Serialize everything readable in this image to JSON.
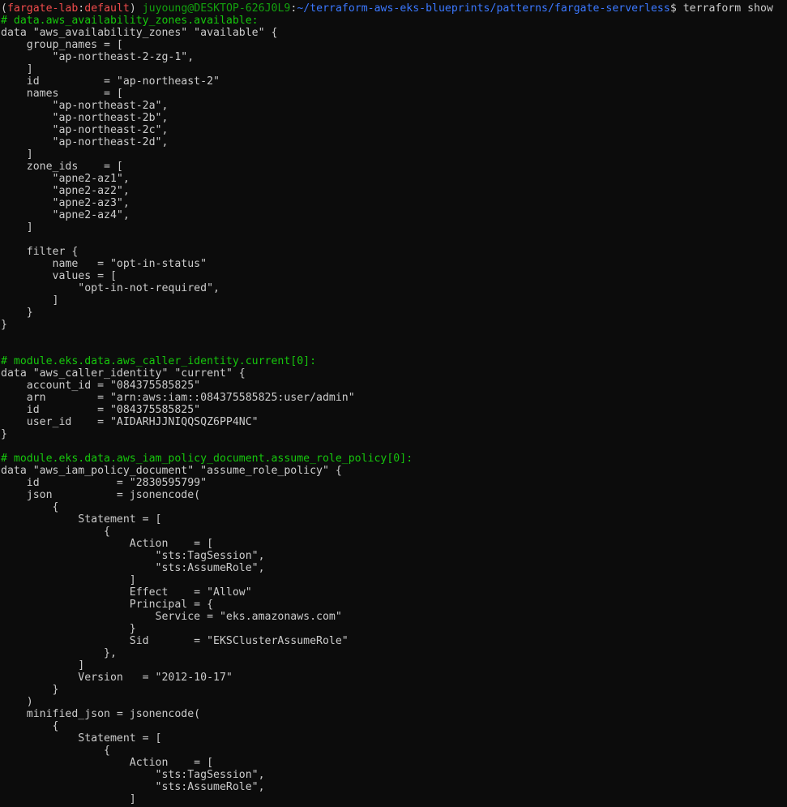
{
  "prompt": {
    "open_paren": "(",
    "env_name": "fargate-lab",
    "env_sep": ":",
    "env_profile": "default",
    "close_paren": ")",
    "user_host": "juyoung@DESKTOP-626J0L9",
    "colon": ":",
    "cwd": "~/terraform-aws-eks-blueprints/patterns/fargate-serverless",
    "symbol": "$",
    "command": "terraform show"
  },
  "colors": {
    "background": "#0c0c0c",
    "text": "#cccccc",
    "env": "#f14c4c",
    "user_host": "#13a10e",
    "path": "#3b78ff",
    "comment": "#16c60c"
  },
  "lines": [
    {
      "type": "comment",
      "text": "# data.aws_availability_zones.available:"
    },
    {
      "type": "code",
      "text": "data \"aws_availability_zones\" \"available\" {"
    },
    {
      "type": "code",
      "text": "    group_names = ["
    },
    {
      "type": "code",
      "text": "        \"ap-northeast-2-zg-1\","
    },
    {
      "type": "code",
      "text": "    ]"
    },
    {
      "type": "code",
      "text": "    id          = \"ap-northeast-2\""
    },
    {
      "type": "code",
      "text": "    names       = ["
    },
    {
      "type": "code",
      "text": "        \"ap-northeast-2a\","
    },
    {
      "type": "code",
      "text": "        \"ap-northeast-2b\","
    },
    {
      "type": "code",
      "text": "        \"ap-northeast-2c\","
    },
    {
      "type": "code",
      "text": "        \"ap-northeast-2d\","
    },
    {
      "type": "code",
      "text": "    ]"
    },
    {
      "type": "code",
      "text": "    zone_ids    = ["
    },
    {
      "type": "code",
      "text": "        \"apne2-az1\","
    },
    {
      "type": "code",
      "text": "        \"apne2-az2\","
    },
    {
      "type": "code",
      "text": "        \"apne2-az3\","
    },
    {
      "type": "code",
      "text": "        \"apne2-az4\","
    },
    {
      "type": "code",
      "text": "    ]"
    },
    {
      "type": "code",
      "text": ""
    },
    {
      "type": "code",
      "text": "    filter {"
    },
    {
      "type": "code",
      "text": "        name   = \"opt-in-status\""
    },
    {
      "type": "code",
      "text": "        values = ["
    },
    {
      "type": "code",
      "text": "            \"opt-in-not-required\","
    },
    {
      "type": "code",
      "text": "        ]"
    },
    {
      "type": "code",
      "text": "    }"
    },
    {
      "type": "code",
      "text": "}"
    },
    {
      "type": "code",
      "text": ""
    },
    {
      "type": "code",
      "text": ""
    },
    {
      "type": "comment",
      "text": "# module.eks.data.aws_caller_identity.current[0]:"
    },
    {
      "type": "code",
      "text": "data \"aws_caller_identity\" \"current\" {"
    },
    {
      "type": "code",
      "text": "    account_id = \"084375585825\""
    },
    {
      "type": "code",
      "text": "    arn        = \"arn:aws:iam::084375585825:user/admin\""
    },
    {
      "type": "code",
      "text": "    id         = \"084375585825\""
    },
    {
      "type": "code",
      "text": "    user_id    = \"AIDARHJJNIQQSQZ6PP4NC\""
    },
    {
      "type": "code",
      "text": "}"
    },
    {
      "type": "code",
      "text": ""
    },
    {
      "type": "comment",
      "text": "# module.eks.data.aws_iam_policy_document.assume_role_policy[0]:"
    },
    {
      "type": "code",
      "text": "data \"aws_iam_policy_document\" \"assume_role_policy\" {"
    },
    {
      "type": "code",
      "text": "    id            = \"2830595799\""
    },
    {
      "type": "code",
      "text": "    json          = jsonencode("
    },
    {
      "type": "code",
      "text": "        {"
    },
    {
      "type": "code",
      "text": "            Statement = ["
    },
    {
      "type": "code",
      "text": "                {"
    },
    {
      "type": "code",
      "text": "                    Action    = ["
    },
    {
      "type": "code",
      "text": "                        \"sts:TagSession\","
    },
    {
      "type": "code",
      "text": "                        \"sts:AssumeRole\","
    },
    {
      "type": "code",
      "text": "                    ]"
    },
    {
      "type": "code",
      "text": "                    Effect    = \"Allow\""
    },
    {
      "type": "code",
      "text": "                    Principal = {"
    },
    {
      "type": "code",
      "text": "                        Service = \"eks.amazonaws.com\""
    },
    {
      "type": "code",
      "text": "                    }"
    },
    {
      "type": "code",
      "text": "                    Sid       = \"EKSClusterAssumeRole\""
    },
    {
      "type": "code",
      "text": "                },"
    },
    {
      "type": "code",
      "text": "            ]"
    },
    {
      "type": "code",
      "text": "            Version   = \"2012-10-17\""
    },
    {
      "type": "code",
      "text": "        }"
    },
    {
      "type": "code",
      "text": "    )"
    },
    {
      "type": "code",
      "text": "    minified_json = jsonencode("
    },
    {
      "type": "code",
      "text": "        {"
    },
    {
      "type": "code",
      "text": "            Statement = ["
    },
    {
      "type": "code",
      "text": "                {"
    },
    {
      "type": "code",
      "text": "                    Action    = ["
    },
    {
      "type": "code",
      "text": "                        \"sts:TagSession\","
    },
    {
      "type": "code",
      "text": "                        \"sts:AssumeRole\","
    },
    {
      "type": "code",
      "text": "                    ]"
    }
  ]
}
